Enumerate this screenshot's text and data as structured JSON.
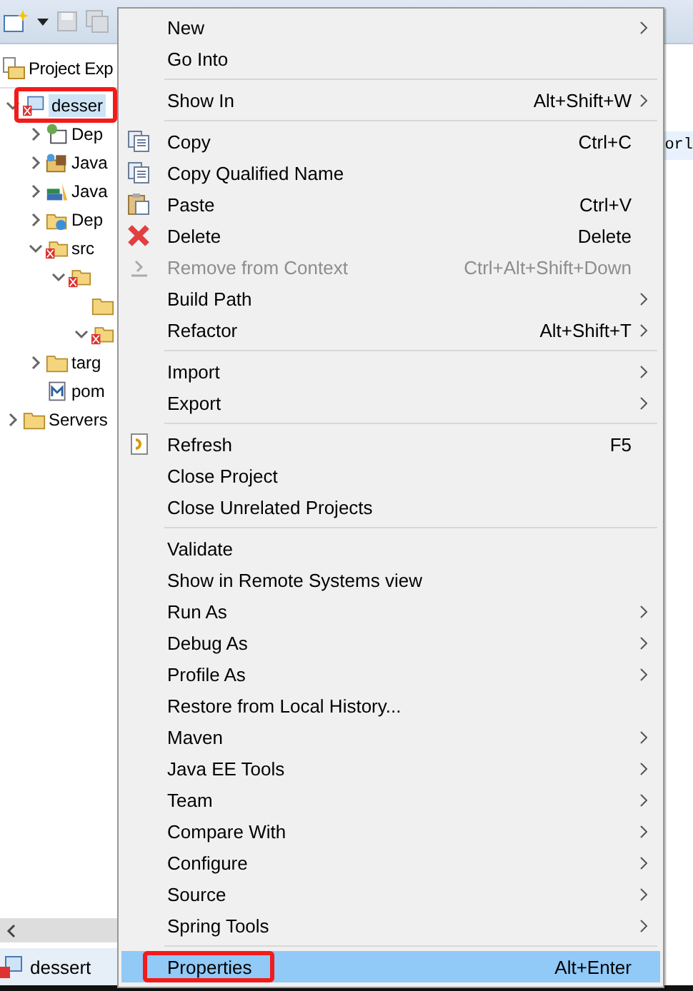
{
  "view": {
    "title": "Project Exp"
  },
  "tree": [
    {
      "label": "desser",
      "kind": "project",
      "expanded": true,
      "selected": true,
      "annotated": true,
      "children": [
        {
          "label": "Dep",
          "kind": "deps",
          "expanded": false
        },
        {
          "label": "Java",
          "kind": "library",
          "expanded": false
        },
        {
          "label": "Java",
          "kind": "books",
          "expanded": false
        },
        {
          "label": "Dep",
          "kind": "globe-folder",
          "expanded": false
        },
        {
          "label": "src",
          "kind": "error-folder",
          "expanded": true,
          "children": [
            {
              "kind": "error-folder",
              "expanded": true,
              "children": [
                {
                  "kind": "folder"
                },
                {
                  "kind": "error-folder",
                  "expanded": true
                }
              ]
            }
          ]
        },
        {
          "label": "targ",
          "kind": "folder",
          "expanded": false
        },
        {
          "label": "pom",
          "kind": "pom"
        }
      ]
    },
    {
      "label": "Servers",
      "kind": "folder",
      "expanded": false
    }
  ],
  "editor": {
    "text": "orl"
  },
  "menu": {
    "groups": [
      [
        {
          "label": "New",
          "submenu": true
        },
        {
          "label": "Go Into"
        }
      ],
      [
        {
          "label": "Show In",
          "shortcut": "Alt+Shift+W",
          "submenu": true
        }
      ],
      [
        {
          "label": "Copy",
          "shortcut": "Ctrl+C",
          "kind": "copy"
        },
        {
          "label": "Copy Qualified Name",
          "kind": "copy-name"
        },
        {
          "label": "Paste",
          "shortcut": "Ctrl+V",
          "kind": "paste"
        },
        {
          "label": "Delete",
          "shortcut": "Delete",
          "kind": "delete"
        },
        {
          "label": "Remove from Context",
          "shortcut": "Ctrl+Alt+Shift+Down",
          "kind": "remove",
          "disabled": true
        },
        {
          "label": "Build Path",
          "submenu": true
        },
        {
          "label": "Refactor",
          "shortcut": "Alt+Shift+T",
          "submenu": true
        }
      ],
      [
        {
          "label": "Import",
          "submenu": true
        },
        {
          "label": "Export",
          "submenu": true
        }
      ],
      [
        {
          "label": "Refresh",
          "shortcut": "F5",
          "kind": "refresh"
        },
        {
          "label": "Close Project"
        },
        {
          "label": "Close Unrelated Projects"
        }
      ],
      [
        {
          "label": "Validate"
        },
        {
          "label": "Show in Remote Systems view"
        },
        {
          "label": "Run As",
          "submenu": true
        },
        {
          "label": "Debug As",
          "submenu": true
        },
        {
          "label": "Profile As",
          "submenu": true
        },
        {
          "label": "Restore from Local History..."
        },
        {
          "label": "Maven",
          "submenu": true
        },
        {
          "label": "Java EE Tools",
          "submenu": true
        },
        {
          "label": "Team",
          "submenu": true
        },
        {
          "label": "Compare With",
          "submenu": true
        },
        {
          "label": "Configure",
          "submenu": true
        },
        {
          "label": "Source",
          "submenu": true
        },
        {
          "label": "Spring Tools",
          "submenu": true
        }
      ],
      [
        {
          "label": "Properties",
          "shortcut": "Alt+Enter",
          "selected": true,
          "annotated": true
        }
      ]
    ]
  },
  "status_bar": {
    "text": "dessert"
  }
}
